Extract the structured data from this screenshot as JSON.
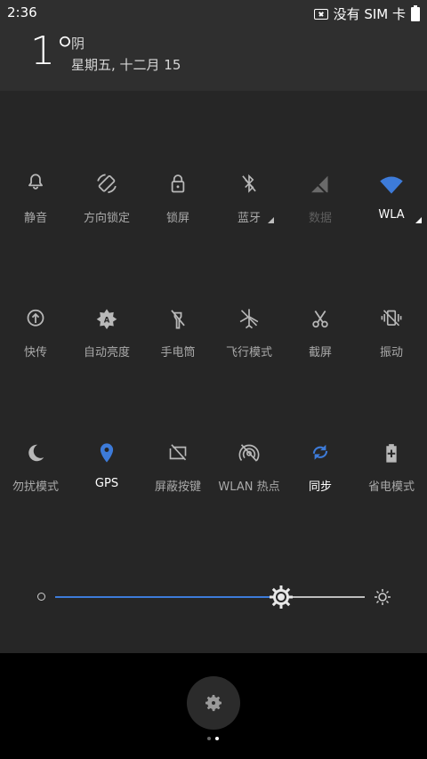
{
  "status": {
    "time": "2:36",
    "sim_text": "没有 SIM 卡"
  },
  "weather": {
    "temp": "1°",
    "condition": "阴",
    "date": "星期五, 十二月 15"
  },
  "tiles": [
    {
      "label": "静音",
      "icon": "bell-icon",
      "state": "off"
    },
    {
      "label": "方向锁定",
      "icon": "rotate-icon",
      "state": "off"
    },
    {
      "label": "锁屏",
      "icon": "lock-icon",
      "state": "off"
    },
    {
      "label": "蓝牙",
      "icon": "bluetooth-off-icon",
      "state": "off",
      "dropdown": true
    },
    {
      "label": "数据",
      "icon": "signal-off-icon",
      "state": "disabled"
    },
    {
      "label": "WLA",
      "icon": "wifi-icon",
      "state": "on",
      "dropdown": true
    },
    {
      "label": "快传",
      "icon": "quick-share-icon",
      "state": "off"
    },
    {
      "label": "自动亮度",
      "icon": "auto-brightness-icon",
      "state": "off"
    },
    {
      "label": "手电筒",
      "icon": "flashlight-icon",
      "state": "off"
    },
    {
      "label": "飞行模式",
      "icon": "airplane-off-icon",
      "state": "off"
    },
    {
      "label": "截屏",
      "icon": "scissors-icon",
      "state": "off"
    },
    {
      "label": "振动",
      "icon": "vibrate-off-icon",
      "state": "off"
    },
    {
      "label": "勿扰模式",
      "icon": "moon-icon",
      "state": "off"
    },
    {
      "label": "GPS",
      "icon": "location-icon",
      "state": "on"
    },
    {
      "label": "屏蔽按键",
      "icon": "keys-off-icon",
      "state": "off"
    },
    {
      "label": "WLAN 热点",
      "icon": "hotspot-off-icon",
      "state": "off"
    },
    {
      "label": "同步",
      "icon": "sync-icon",
      "state": "on"
    },
    {
      "label": "省电模式",
      "icon": "battery-saver-icon",
      "state": "off"
    }
  ],
  "brightness": {
    "level": 0.73
  },
  "pager": {
    "pages": 2,
    "current": 2
  },
  "colors": {
    "accent": "#3d7bd9",
    "panel": "#262626",
    "header": "#2f2f2f"
  }
}
